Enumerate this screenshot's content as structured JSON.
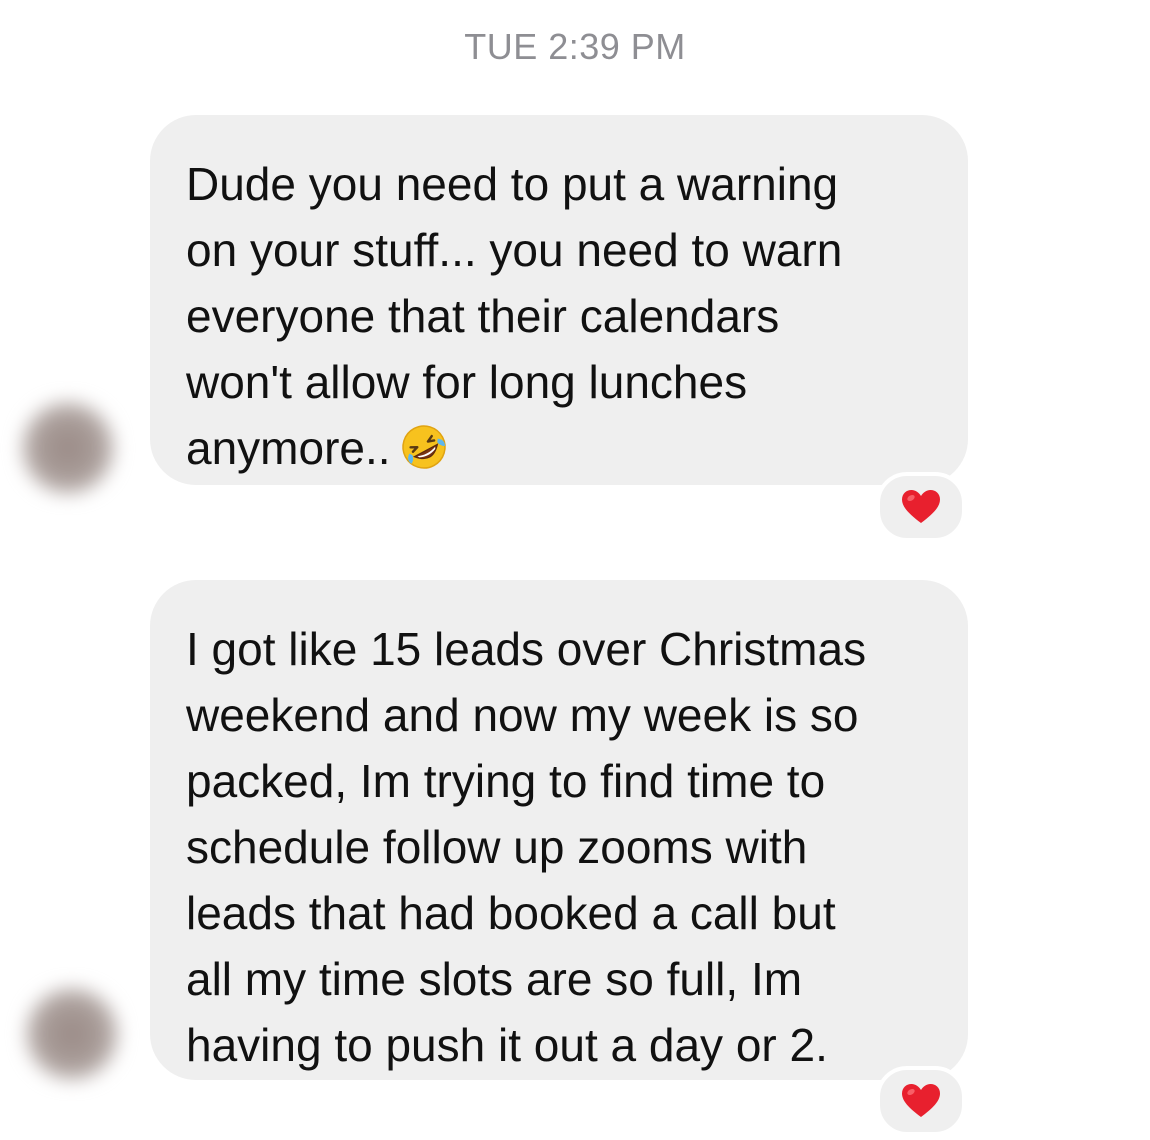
{
  "timestamp": "TUE 2:39 PM",
  "messages": [
    {
      "lines": [
        "Dude you need to put a warning",
        "on your stuff... you need to warn",
        "everyone that their calendars",
        "won't allow for long lunches",
        "anymore.."
      ],
      "emoji": "rolling-on-floor-laughing",
      "reaction": "heart",
      "colors": {
        "bubble": "#efefef",
        "text": "#111111",
        "heart": "#e8202e"
      }
    },
    {
      "lines": [
        "I got like 15 leads over Christmas",
        "weekend and now my week is so",
        "packed, Im trying to find time to",
        "schedule follow up zooms with",
        "leads that had booked a call but",
        "all my time slots are so full, Im",
        "having to push it out a day or 2."
      ],
      "reaction": "heart"
    }
  ]
}
